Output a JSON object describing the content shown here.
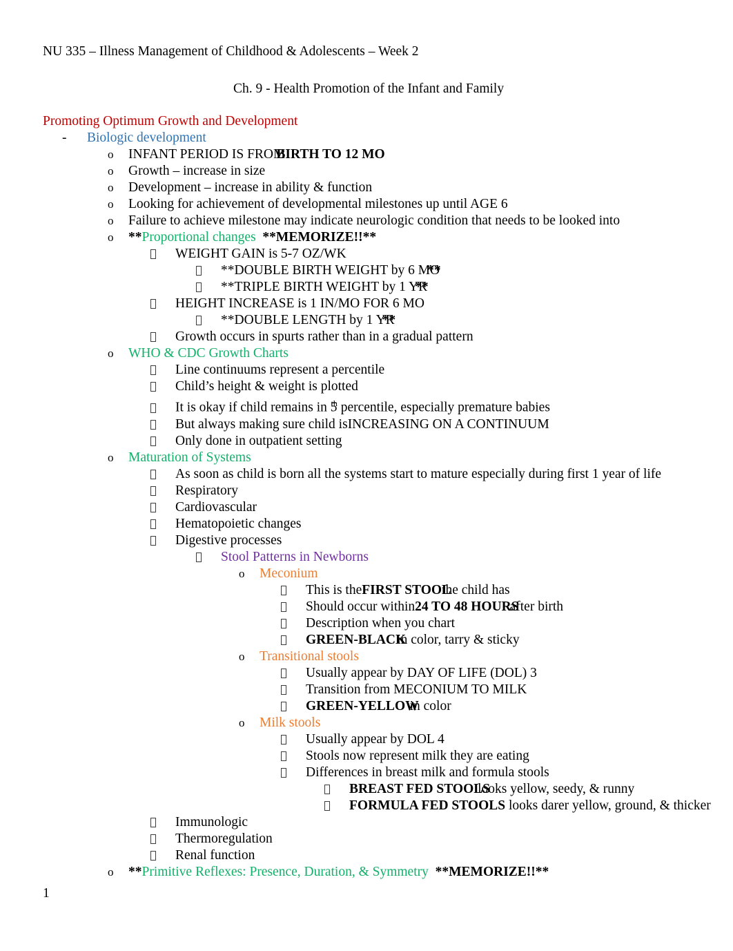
{
  "document": {
    "header": "NU 335 – Illness Management of Childhood & Adolescents – Week 2",
    "subtitle": "Ch. 9 - Health Promotion of the Infant and Family",
    "page_number": "1"
  },
  "colors": {
    "red": "#C00000",
    "blue": "#2E74B5",
    "green": "#13B06A",
    "purple": "#7030A0",
    "orange": "#ED7D31",
    "black": "#000000"
  },
  "section": {
    "title": "Promoting Optimum Growth and Development",
    "biologic_development": "Biologic development"
  },
  "markers": {
    "dash": "-",
    "o": "o"
  },
  "bullets": {
    "infant_period_plain": "INFANT PERIOD IS FROM",
    "infant_period_bold": "BIRTH TO 12 MO",
    "growth": "Growth – increase in size",
    "development": "Development – increase in ability & function",
    "milestones": "Looking for achievement of developmental milestones up until AGE 6",
    "failure": "Failure to achieve milestone may indicate neurologic condition that needs to be looked into",
    "proportional_stars": "**",
    "proportional_changes": "Proportional changes",
    "proportional_memorize": "**MEMORIZE!!**",
    "weight_gain": "WEIGHT GAIN is 5-7 OZ/WK",
    "double_birth_weight": "**DOUBLE BIRTH WEIGHT by 6 MO",
    "double_birth_weight_stars": "**",
    "triple_birth_weight": "**TRIPLE BIRTH WEIGHT by 1 YR",
    "triple_birth_weight_stars": "**",
    "height_increase": "HEIGHT INCREASE is 1 IN/MO FOR 6 MO",
    "double_length": "**DOUBLE LENGTH by 1 YR",
    "double_length_stars": "**",
    "growth_spurts": "Growth occurs in spurts rather than in a gradual pattern"
  },
  "growth_charts": {
    "heading": "WHO & CDC Growth Charts",
    "items": [
      "Line continuums represent a percentile",
      "Child’s height & weight is plotted",
      "Only done in outpatient setting"
    ],
    "percentile_pre": "It is okay if child remains in 5",
    "percentile_sup": "th",
    "percentile_post": " percentile, especially premature babies",
    "continuum_plain": "But always making sure child is",
    "continuum_bold": "INCREASING ON A CONTINUUM"
  },
  "maturation": {
    "heading": "Maturation of Systems",
    "items": [
      "As soon as child is born all the systems start to mature especially during first 1 year of life",
      "Respiratory",
      "Cardiovascular",
      "Hematopoietic changes",
      "Digestive processes"
    ],
    "trailing_items": [
      "Immunologic",
      "Thermoregulation",
      "Renal function"
    ]
  },
  "stool_patterns": {
    "heading": "Stool Patterns in Newborns",
    "meconium": {
      "heading": "Meconium",
      "first_stool_pre": "This is the",
      "first_stool_bold": "FIRST STOOL",
      "first_stool_post": "the child has",
      "hours_pre": "Should occur within",
      "hours_bold": "24 TO 48 HOURS",
      "hours_post": "after birth",
      "description": "Description when you chart",
      "color_bold": "GREEN-BLACK",
      "color_post": "in color, tarry & sticky"
    },
    "transitional": {
      "heading": "Transitional stools",
      "dol3": "Usually appear by DAY OF LIFE (DOL) 3",
      "transition": "Transition from MECONIUM TO MILK",
      "color_bold": "GREEN-YELLOW",
      "color_post": "in color"
    },
    "milk": {
      "heading": "Milk stools",
      "dol4": "Usually appear by DOL 4",
      "represent": "Stools now represent milk they are eating",
      "differences": "Differences in breast milk and formula stools",
      "breast_bold": "BREAST FED STOOLS",
      "breast_post": "looks yellow, seedy, & runny",
      "formula_bold": "FORMULA FED STOOLS",
      "formula_post": " looks darer yellow, ground, & thicker"
    }
  },
  "primitive_reflexes": {
    "stars": "**",
    "text": "Primitive Reflexes: Presence, Duration, & Symmetry",
    "memorize": "**MEMORIZE!!**"
  }
}
